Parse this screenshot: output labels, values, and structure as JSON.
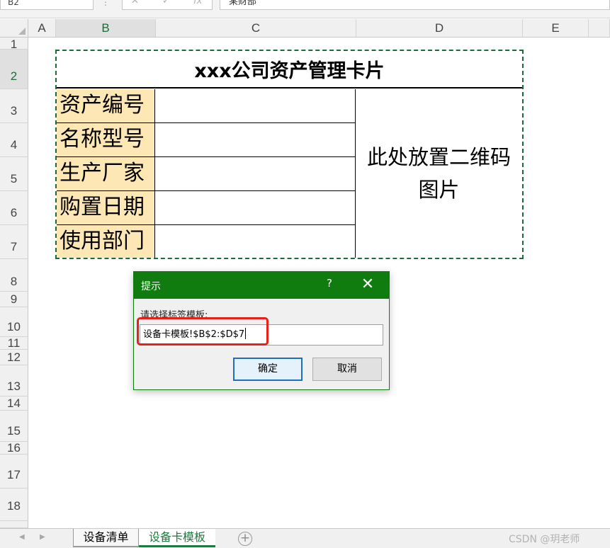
{
  "formula_bar": {
    "name_box": "B2",
    "dots": "⋮",
    "cancel_glyph": "✕",
    "enter_glyph": "✓",
    "fx_glyph": "fx",
    "content": "某财部"
  },
  "columns": [
    "A",
    "B",
    "C",
    "D",
    "E"
  ],
  "rows": [
    "1",
    "2",
    "3",
    "4",
    "5",
    "6",
    "7",
    "8",
    "9",
    "10",
    "11",
    "12",
    "13",
    "14",
    "15",
    "16",
    "17",
    "18"
  ],
  "card": {
    "title": "xxx公司资产管理卡片",
    "labels": [
      "资产编号",
      "名称型号",
      "生产厂家",
      "购置日期",
      "使用部门"
    ],
    "qr_placeholder": "此处放置二维码图片"
  },
  "dialog": {
    "title": "提示",
    "help": "?",
    "close": "✕",
    "prompt": "请选择标签模板:",
    "input_value": "设备卡模板!$B$2:$D$7",
    "ok_label": "确定",
    "cancel_label": "取消"
  },
  "sheets": {
    "prev_arrow": "◀",
    "next_arrow": "▶",
    "tabs": [
      "设备清单",
      "设备卡模板"
    ],
    "add": "+"
  },
  "watermark": "CSDN @玥老师",
  "colors": {
    "accent": "#107c10",
    "label_fill": "#fde7b4",
    "highlight": "#e8201a",
    "active_tab": "#1d7a3e"
  }
}
